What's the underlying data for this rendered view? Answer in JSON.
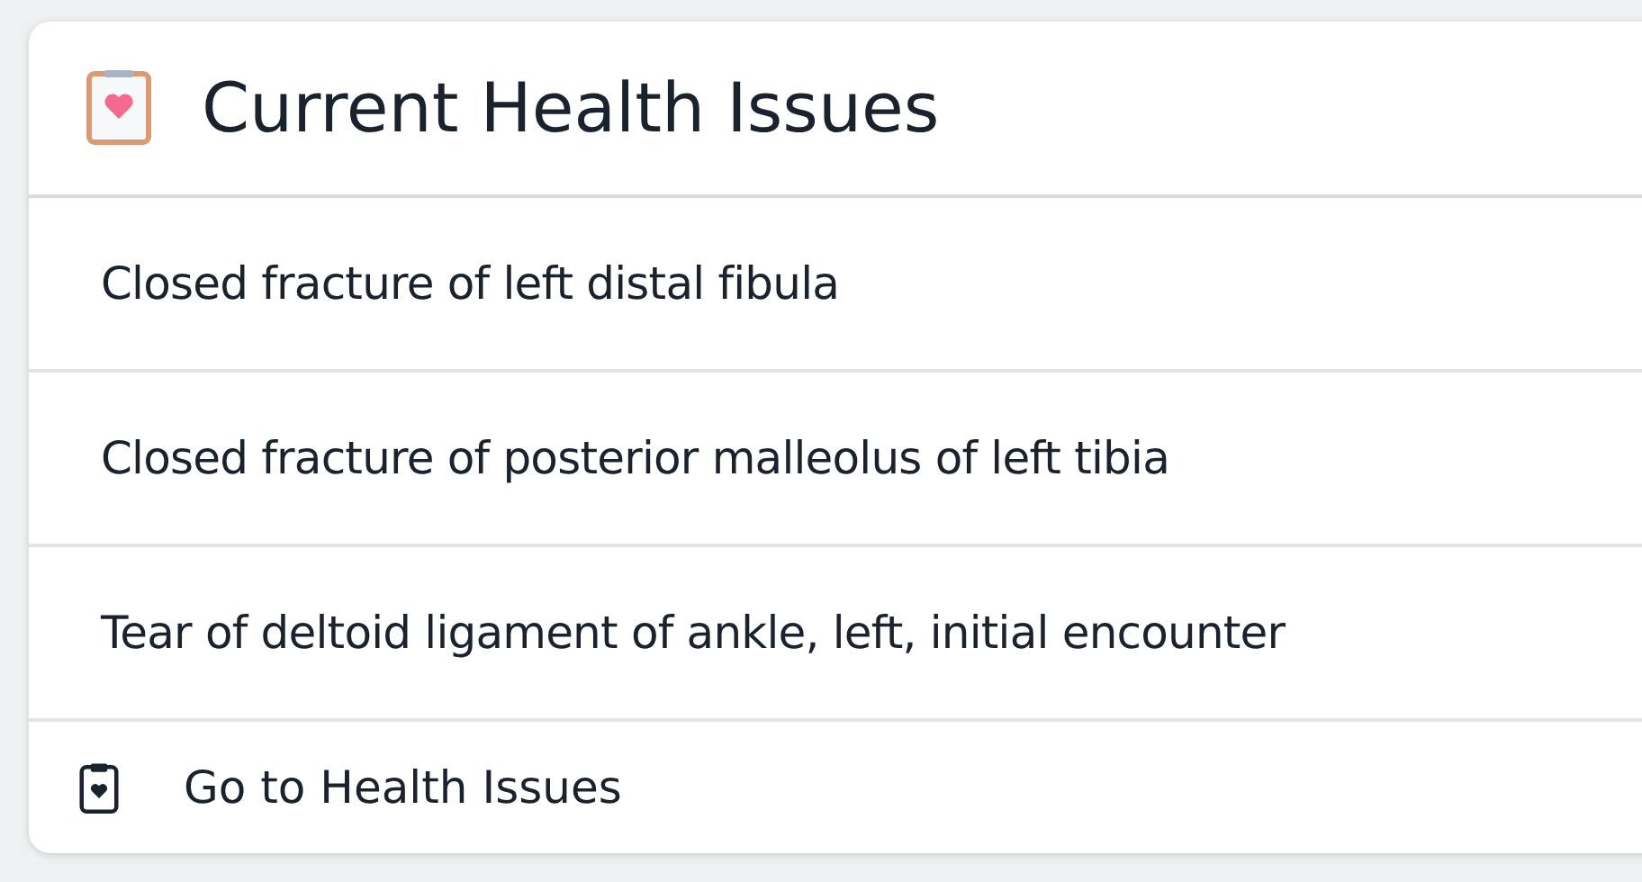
{
  "card": {
    "title": "Current Health Issues",
    "issues": [
      {
        "label": "Closed fracture of left distal fibula"
      },
      {
        "label": "Closed fracture of posterior malleolus of left tibia"
      },
      {
        "label": "Tear of deltoid ligament of ankle, left, initial encounter"
      }
    ],
    "footer_link": "Go to Health Issues"
  }
}
